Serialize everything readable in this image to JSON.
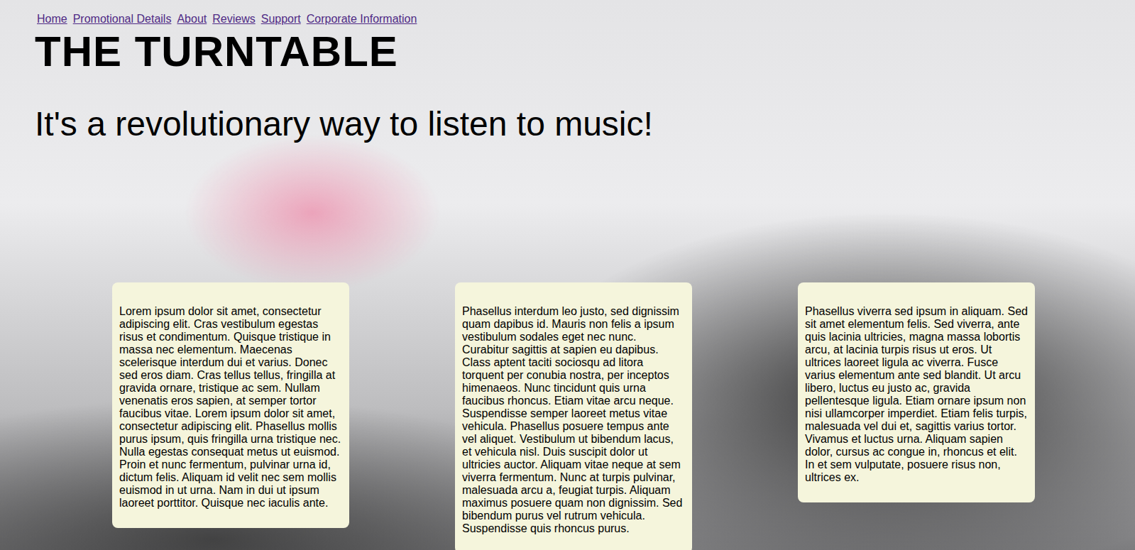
{
  "nav": {
    "links": [
      "Home",
      "Promotional Details",
      "About",
      "Reviews",
      "Support",
      "Corporate Information"
    ]
  },
  "header": {
    "title": "THE TURNTABLE",
    "tagline": "It's a revolutionary way to listen to music!"
  },
  "cards": [
    {
      "text": "Lorem ipsum dolor sit amet, consectetur adipiscing elit. Cras vestibulum egestas risus et condimentum. Quisque tristique in massa nec elementum. Maecenas scelerisque interdum dui et varius. Donec sed eros diam. Cras tellus tellus, fringilla at gravida ornare, tristique ac sem. Nullam venenatis eros sapien, at semper tortor faucibus vitae. Lorem ipsum dolor sit amet, consectetur adipiscing elit. Phasellus mollis purus ipsum, quis fringilla urna tristique nec. Nulla egestas consequat metus ut euismod. Proin et nunc fermentum, pulvinar urna id, dictum felis. Aliquam id velit nec sem mollis euismod in ut urna. Nam in dui ut ipsum laoreet porttitor. Quisque nec iaculis ante."
    },
    {
      "text": "Phasellus interdum leo justo, sed dignissim quam dapibus id. Mauris non felis a ipsum vestibulum sodales eget nec nunc. Curabitur sagittis at sapien eu dapibus. Class aptent taciti sociosqu ad litora torquent per conubia nostra, per inceptos himenaeos. Nunc tincidunt quis urna faucibus rhoncus. Etiam vitae arcu neque. Suspendisse semper laoreet metus vitae vehicula. Phasellus posuere tempus ante vel aliquet. Vestibulum ut bibendum lacus, et vehicula nisl. Duis suscipit dolor ut ultricies auctor. Aliquam vitae neque at sem viverra fermentum. Nunc at turpis pulvinar, malesuada arcu a, feugiat turpis. Aliquam maximus posuere quam non dignissim. Sed bibendum purus vel rutrum vehicula. Suspendisse quis rhoncus purus."
    },
    {
      "text": "Phasellus viverra sed ipsum in aliquam. Sed sit amet elementum felis. Sed viverra, ante quis lacinia ultricies, magna massa lobortis arcu, at lacinia turpis risus ut eros. Ut ultrices laoreet ligula ac viverra. Fusce varius elementum ante sed blandit. Ut arcu libero, luctus eu justo ac, gravida pellentesque ligula. Etiam ornare ipsum non nisi ullamcorper imperdiet. Etiam felis turpis, malesuada vel dui et, sagittis varius tortor. Vivamus et luctus urna. Aliquam sapien dolor, cursus ac congue in, rhoncus et elit. In et sem vulputate, posuere risus non, ultrices ex."
    }
  ]
}
